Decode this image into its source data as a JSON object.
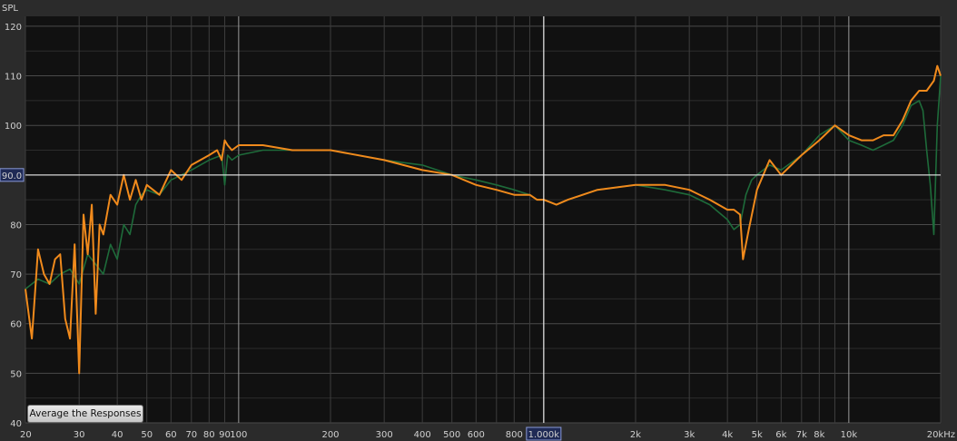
{
  "chart_data": {
    "type": "line",
    "ylabel": "SPL",
    "xscale": "log",
    "xlim": [
      20,
      20000
    ],
    "ylim": [
      40,
      122
    ],
    "grid": true,
    "x_ticks": [
      {
        "v": 20,
        "label": "20"
      },
      {
        "v": 30,
        "label": "30"
      },
      {
        "v": 40,
        "label": "40"
      },
      {
        "v": 50,
        "label": "50"
      },
      {
        "v": 60,
        "label": "60"
      },
      {
        "v": 70,
        "label": "70"
      },
      {
        "v": 80,
        "label": "80"
      },
      {
        "v": 90,
        "label": "90"
      },
      {
        "v": 100,
        "label": "100"
      },
      {
        "v": 200,
        "label": "200"
      },
      {
        "v": 300,
        "label": "300"
      },
      {
        "v": 400,
        "label": "400"
      },
      {
        "v": 500,
        "label": "500"
      },
      {
        "v": 600,
        "label": "600"
      },
      {
        "v": 800,
        "label": "800"
      },
      {
        "v": 2000,
        "label": "2k"
      },
      {
        "v": 3000,
        "label": "3k"
      },
      {
        "v": 4000,
        "label": "4k"
      },
      {
        "v": 5000,
        "label": "5k"
      },
      {
        "v": 6000,
        "label": "6k"
      },
      {
        "v": 7000,
        "label": "7k"
      },
      {
        "v": 8000,
        "label": "8k"
      },
      {
        "v": 10000,
        "label": "10k"
      },
      {
        "v": 20000,
        "label": "20kHz"
      }
    ],
    "y_ticks": [
      40,
      50,
      60,
      70,
      80,
      100,
      110,
      120
    ],
    "cursor": {
      "x": 1000,
      "y": 90,
      "x_label": "1.000k",
      "y_label": "90.0"
    },
    "series": [
      {
        "color": "#1e6b3a",
        "x": [
          20,
          22,
          24,
          26,
          28,
          30,
          32,
          34,
          36,
          38,
          40,
          42,
          44,
          46,
          48,
          50,
          55,
          60,
          65,
          70,
          80,
          88,
          90,
          92,
          95,
          100,
          120,
          150,
          200,
          300,
          400,
          500,
          600,
          700,
          800,
          900,
          950,
          1000,
          1100,
          1200,
          1500,
          2000,
          2500,
          3000,
          3500,
          4000,
          4200,
          4400,
          4600,
          4800,
          5000,
          5500,
          6000,
          7000,
          8000,
          9000,
          10000,
          11000,
          12000,
          13000,
          14000,
          15000,
          16000,
          17000,
          17500,
          18000,
          18500,
          19000,
          19500,
          20000
        ],
        "y": [
          67,
          69,
          68,
          70,
          71,
          68,
          74,
          72,
          70,
          76,
          73,
          80,
          78,
          84,
          86,
          87,
          86,
          89,
          90,
          91,
          93,
          94,
          88,
          94,
          93,
          94,
          95,
          95,
          95,
          93,
          92,
          90,
          89,
          88,
          87,
          86,
          85,
          85,
          84,
          85,
          87,
          88,
          87,
          86,
          84,
          81,
          79,
          80,
          86,
          89,
          90,
          92,
          91,
          94,
          98,
          100,
          97,
          96,
          95,
          96,
          97,
          100,
          104,
          105,
          103,
          95,
          88,
          78,
          100,
          110
        ],
        "width": 1.6
      },
      {
        "color": "#f08a1c",
        "x": [
          20,
          21,
          22,
          23,
          24,
          25,
          26,
          27,
          28,
          29,
          30,
          31,
          32,
          33,
          34,
          35,
          36,
          38,
          40,
          42,
          44,
          46,
          48,
          50,
          55,
          60,
          65,
          70,
          80,
          85,
          88,
          90,
          92,
          95,
          100,
          120,
          150,
          200,
          300,
          400,
          500,
          600,
          700,
          800,
          900,
          950,
          1000,
          1100,
          1200,
          1500,
          2000,
          2500,
          3000,
          3500,
          4000,
          4200,
          4400,
          4500,
          4700,
          5000,
          5500,
          6000,
          7000,
          8000,
          9000,
          10000,
          11000,
          12000,
          13000,
          14000,
          15000,
          16000,
          17000,
          18000,
          19000,
          19500,
          20000
        ],
        "y": [
          67,
          57,
          75,
          70,
          68,
          73,
          74,
          61,
          57,
          76,
          50,
          82,
          74,
          84,
          62,
          80,
          78,
          86,
          84,
          90,
          85,
          89,
          85,
          88,
          86,
          91,
          89,
          92,
          94,
          95,
          93,
          97,
          96,
          95,
          96,
          96,
          95,
          95,
          93,
          91,
          90,
          88,
          87,
          86,
          86,
          85,
          85,
          84,
          85,
          87,
          88,
          88,
          87,
          85,
          83,
          83,
          82,
          73,
          79,
          87,
          93,
          90,
          94,
          97,
          100,
          98,
          97,
          97,
          98,
          98,
          101,
          105,
          107,
          107,
          109,
          112,
          110
        ],
        "width": 2.0
      }
    ]
  },
  "ui": {
    "average_button_label": "Average the Responses"
  }
}
